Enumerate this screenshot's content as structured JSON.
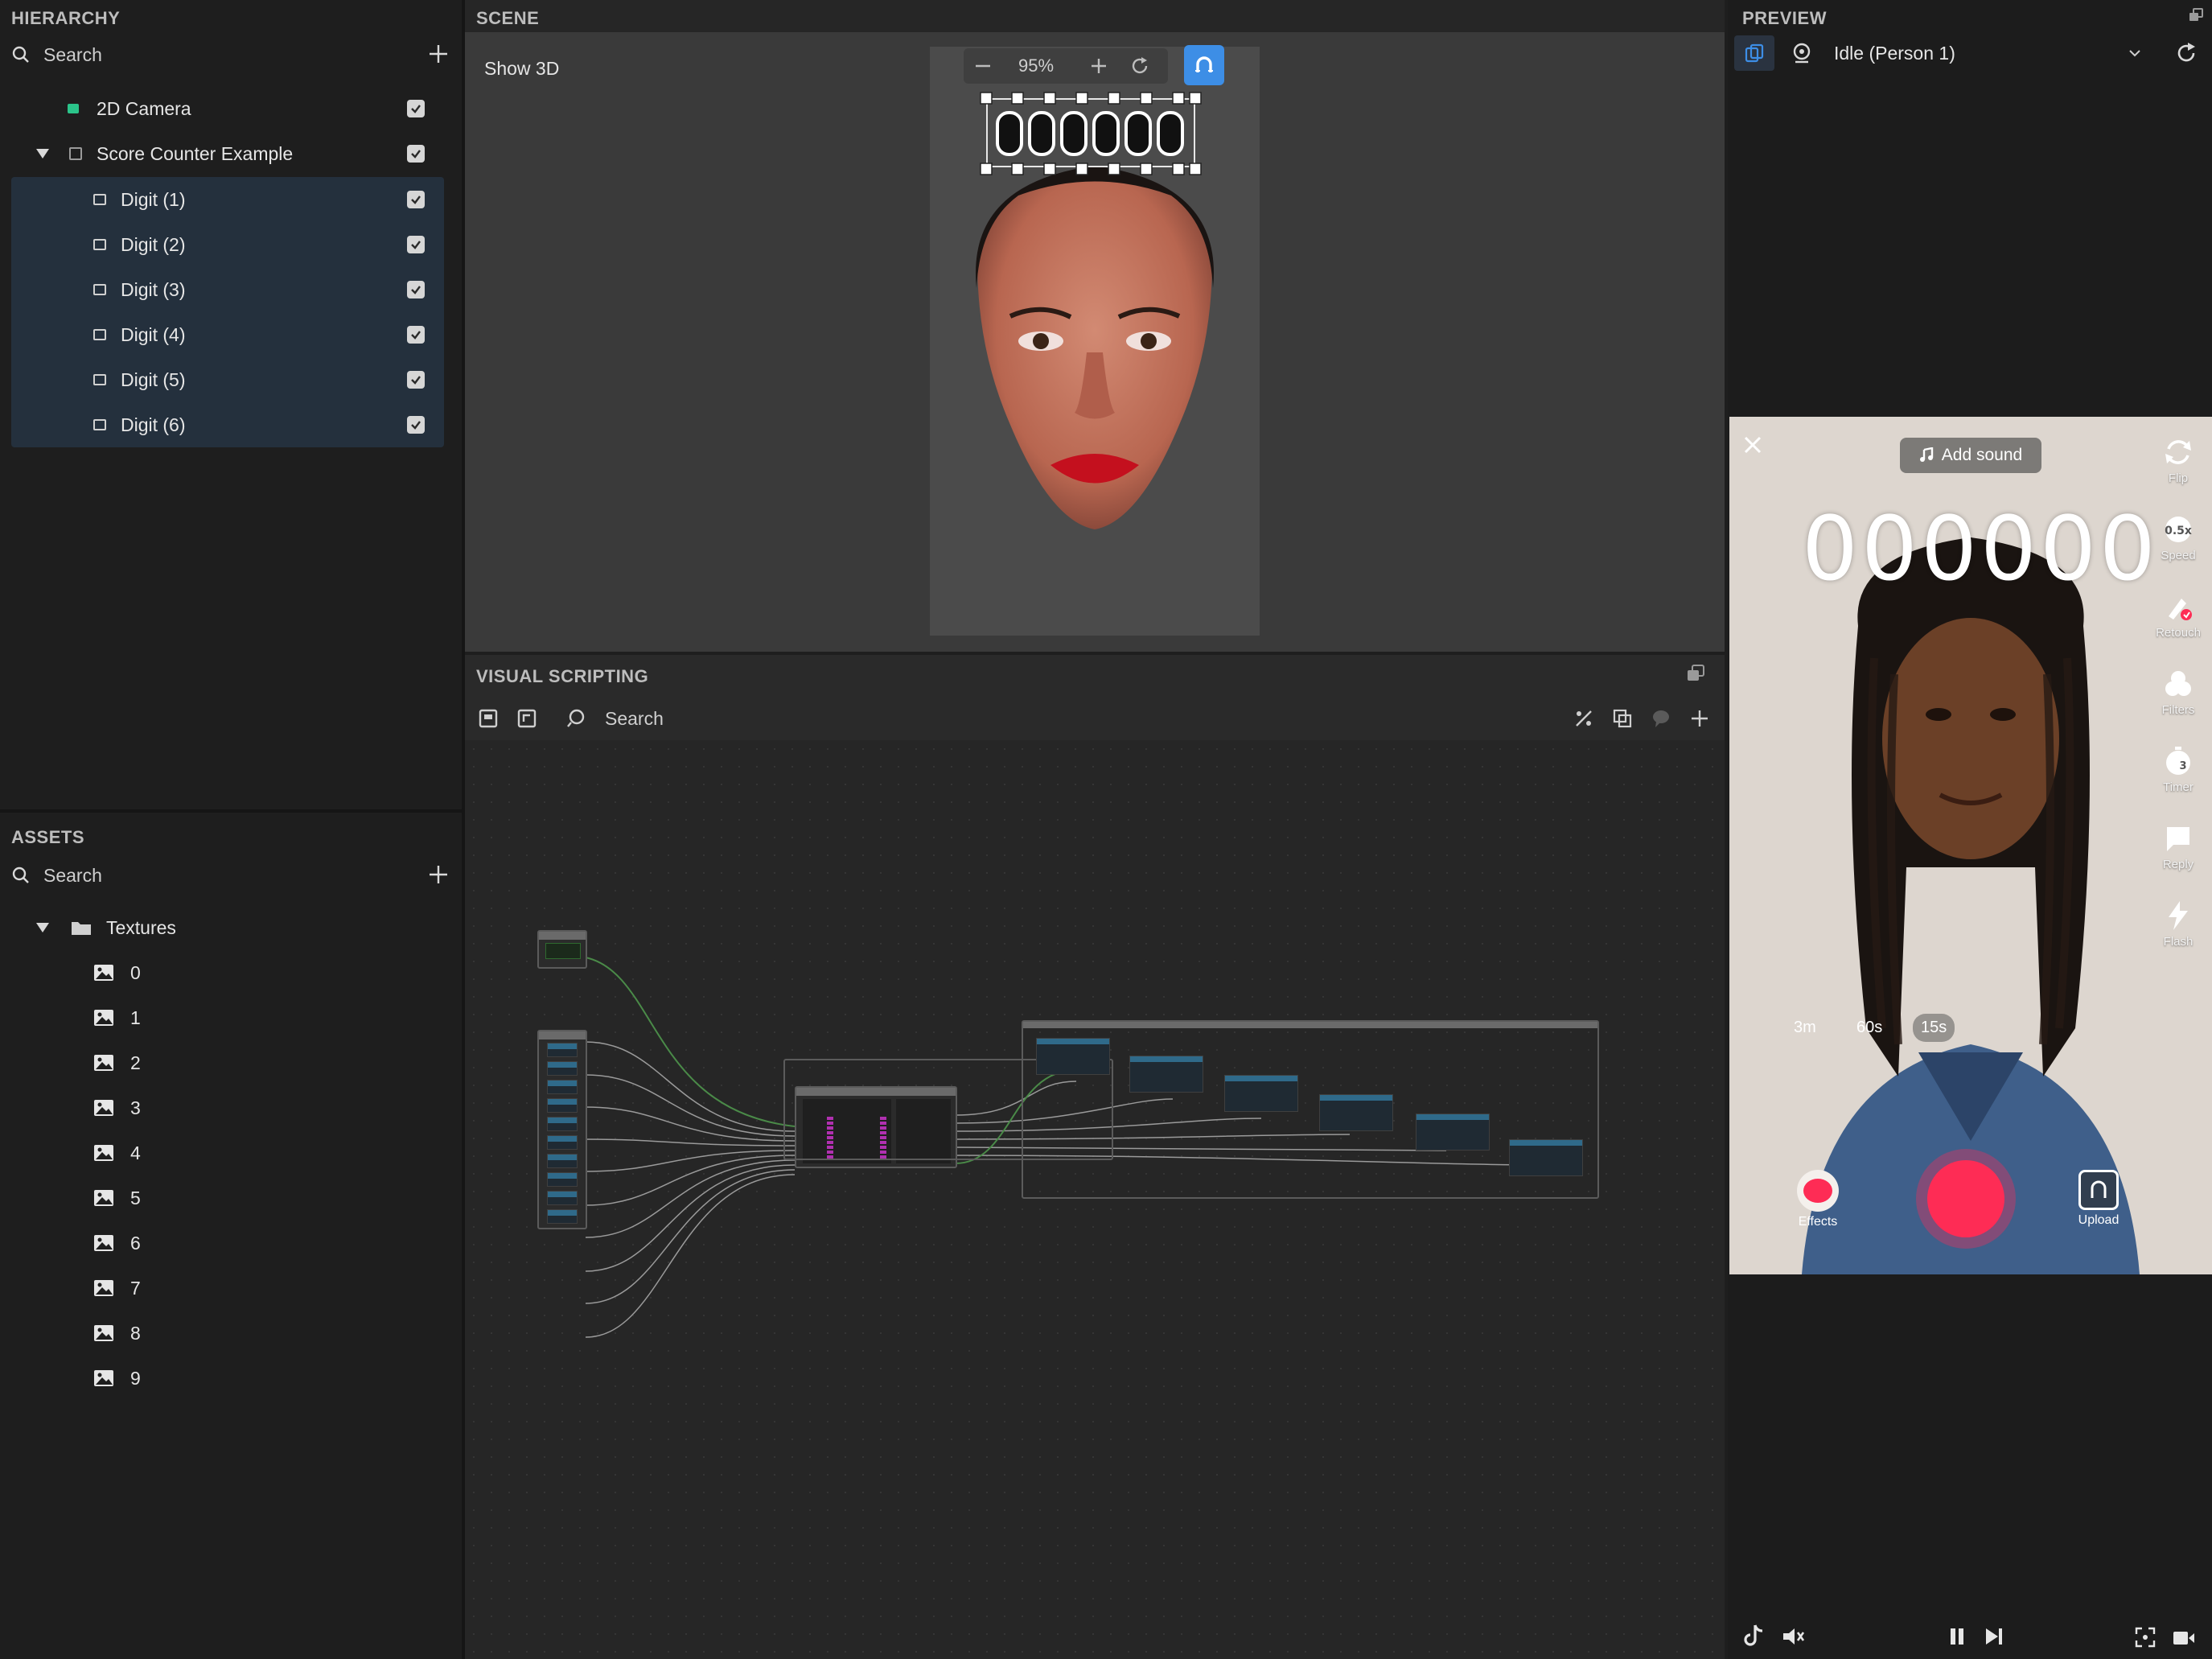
{
  "hierarchy": {
    "title": "HIERARCHY",
    "search_placeholder": "Search",
    "items": [
      {
        "label": "2D Camera",
        "icon": "camera-icon"
      },
      {
        "label": "Score Counter Example",
        "icon": "object-icon"
      },
      {
        "label": "Digit (1)",
        "icon": "image-icon"
      },
      {
        "label": "Digit (2)",
        "icon": "image-icon"
      },
      {
        "label": "Digit (3)",
        "icon": "image-icon"
      },
      {
        "label": "Digit (4)",
        "icon": "image-icon"
      },
      {
        "label": "Digit (5)",
        "icon": "image-icon"
      },
      {
        "label": "Digit (6)",
        "icon": "image-icon"
      }
    ]
  },
  "assets": {
    "title": "ASSETS",
    "search_placeholder": "Search",
    "folder": "Textures",
    "items": [
      "0",
      "1",
      "2",
      "3",
      "4",
      "5",
      "6",
      "7",
      "8",
      "9"
    ]
  },
  "scene": {
    "title": "SCENE",
    "show3d": "Show 3D",
    "zoom": "95%"
  },
  "visual_scripting": {
    "title": "VISUAL SCRIPTING",
    "search_placeholder": "Search"
  },
  "preview": {
    "title": "PREVIEW",
    "dropdown": "Idle (Person 1)",
    "add_sound": "Add sound",
    "score": "000000",
    "side_buttons": [
      "Flip",
      "Speed",
      "Retouch",
      "Filters",
      "Timer",
      "Reply",
      "Flash"
    ],
    "durations": [
      "3m",
      "60s",
      "15s"
    ],
    "effects": "Effects",
    "upload": "Upload",
    "speed_badge": "0.5x",
    "timer_badge": "3"
  },
  "colors": {
    "accent": "#3d8ee6",
    "record": "#fe2c55",
    "selected_row": "#24303d"
  }
}
